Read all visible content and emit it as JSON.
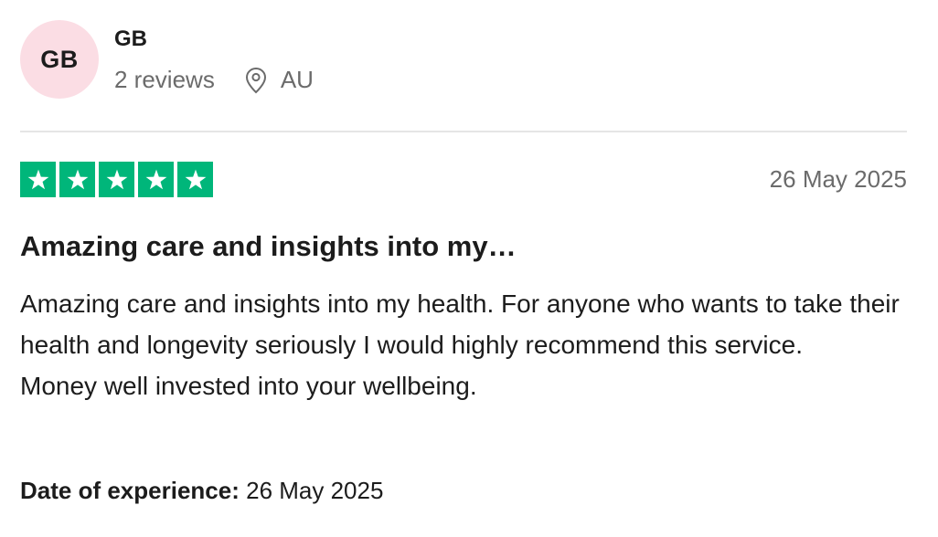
{
  "reviewer": {
    "initials": "GB",
    "name": "GB",
    "review_count": "2 reviews",
    "location": "AU",
    "location_icon": "location-pin-icon",
    "avatar_color": "#fbdde4"
  },
  "review": {
    "rating": 5,
    "max_rating": 5,
    "star_color": "#00b67a",
    "date": "26 May 2025",
    "title": "Amazing care and insights into my…",
    "body_lines": [
      "Amazing care and insights into my health. For anyone who wants to take their health and longevity seriously I would highly recommend this service.",
      "Money well invested into your wellbeing."
    ],
    "experience_label": "Date of experience:",
    "experience_date": "26 May 2025"
  }
}
